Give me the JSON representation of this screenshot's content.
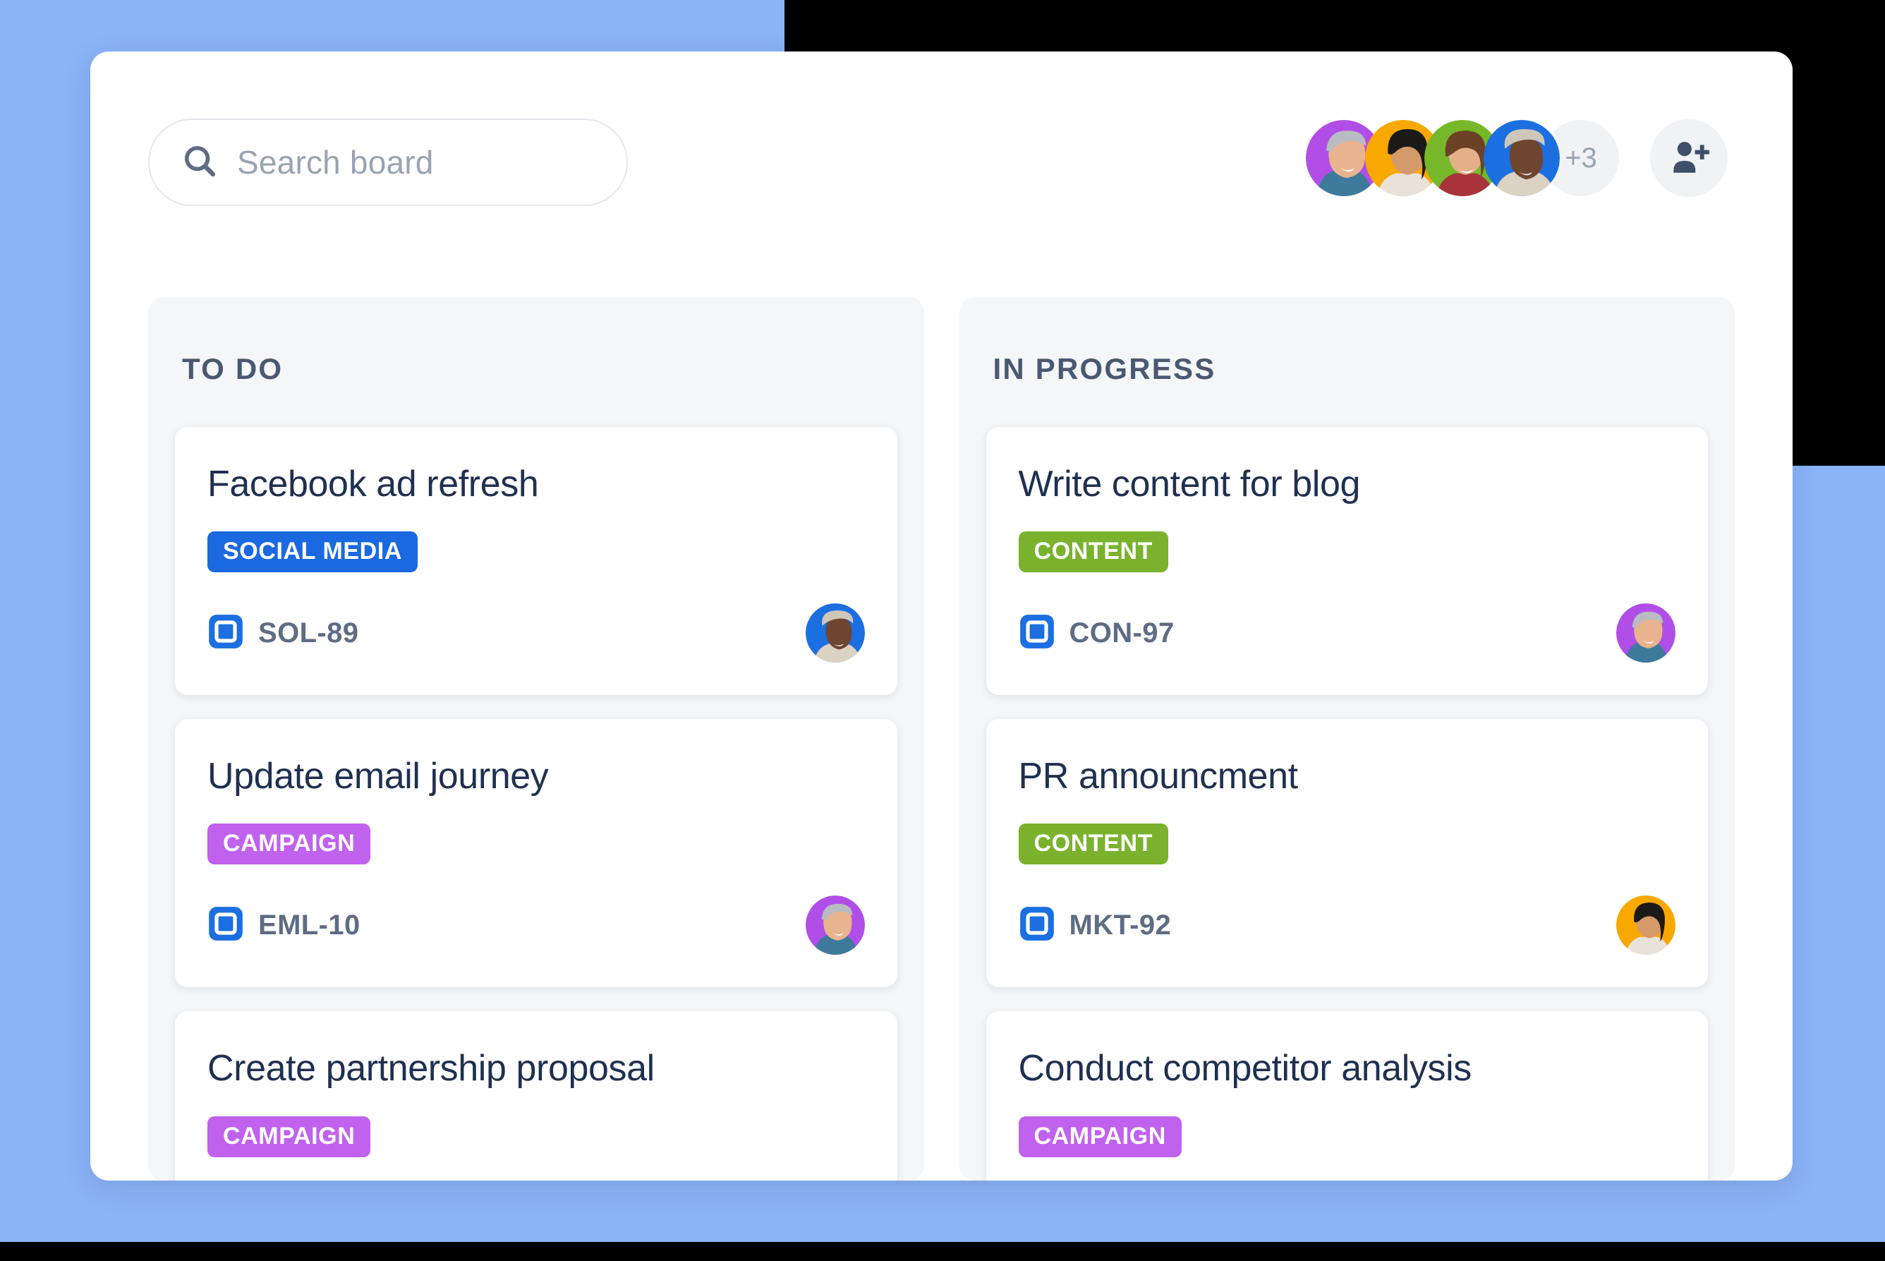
{
  "theme": {
    "backdrop_blue": "#8AB4F8",
    "panel_white": "#FFFFFF",
    "column_bg": "#F4F6F8",
    "title_navy": "#1F3050",
    "muted_gray": "#5E6C84",
    "page_black": "#000000"
  },
  "search": {
    "placeholder": "Search board",
    "value": "",
    "icon": "search-icon"
  },
  "members": {
    "overflow_label": "+3",
    "add_icon": "add-person-icon",
    "avatars": [
      {
        "name": "member-avatar-1",
        "bg": "#B14EE8",
        "skin": "#E8B48F",
        "hair": "#B9BCC2",
        "shirt": "#3E7A9C"
      },
      {
        "name": "member-avatar-2",
        "bg": "#F9A800",
        "skin": "#D49A6A",
        "hair": "#1C1A19",
        "shirt": "#E8E2D8"
      },
      {
        "name": "member-avatar-3",
        "bg": "#76B82A",
        "skin": "#E3B089",
        "hair": "#6B4226",
        "shirt": "#A8333A"
      },
      {
        "name": "member-avatar-4",
        "bg": "#1B6FE0",
        "skin": "#6E4630",
        "hair": "#CFC6BA",
        "shirt": "#DCD2C4"
      }
    ]
  },
  "board": {
    "columns": [
      {
        "id": "todo",
        "title": "TO DO",
        "cards": [
          {
            "title": "Facebook ad refresh",
            "label": "SOCIAL MEDIA",
            "label_color": "#1B69E0",
            "issue_key": "SOL-89",
            "issue_type_icon": "task-icon",
            "assignee": {
              "name": "card-avatar-sol-89",
              "bg": "#1B6FE0",
              "skin": "#6E4630",
              "hair": "#CFC6BA",
              "shirt": "#DCD2C4"
            }
          },
          {
            "title": "Update email journey",
            "label": "CAMPAIGN",
            "label_color": "#C062EE",
            "issue_key": "EML-10",
            "issue_type_icon": "task-icon",
            "assignee": {
              "name": "card-avatar-eml-10",
              "bg": "#B14EE8",
              "skin": "#E8B48F",
              "hair": "#B9BCC2",
              "shirt": "#3E7A9C"
            }
          },
          {
            "title": "Create partnership proposal",
            "label": "CAMPAIGN",
            "label_color": "#C062EE",
            "issue_key": "",
            "issue_type_icon": "task-icon",
            "assignee": null
          }
        ]
      },
      {
        "id": "in-progress",
        "title": "IN PROGRESS",
        "cards": [
          {
            "title": "Write content for blog",
            "label": "CONTENT",
            "label_color": "#7AB22E",
            "issue_key": "CON-97",
            "issue_type_icon": "task-icon",
            "assignee": {
              "name": "card-avatar-con-97",
              "bg": "#B14EE8",
              "skin": "#E8B48F",
              "hair": "#B9BCC2",
              "shirt": "#3E7A9C"
            }
          },
          {
            "title": "PR announcment",
            "label": "CONTENT",
            "label_color": "#7AB22E",
            "issue_key": "MKT-92",
            "issue_type_icon": "task-icon",
            "assignee": {
              "name": "card-avatar-mkt-92",
              "bg": "#F9A800",
              "skin": "#D49A6A",
              "hair": "#1C1A19",
              "shirt": "#E8E2D8"
            }
          },
          {
            "title": "Conduct competitor analysis",
            "label": "CAMPAIGN",
            "label_color": "#C062EE",
            "issue_key": "",
            "issue_type_icon": "task-icon",
            "assignee": null
          }
        ]
      }
    ]
  }
}
